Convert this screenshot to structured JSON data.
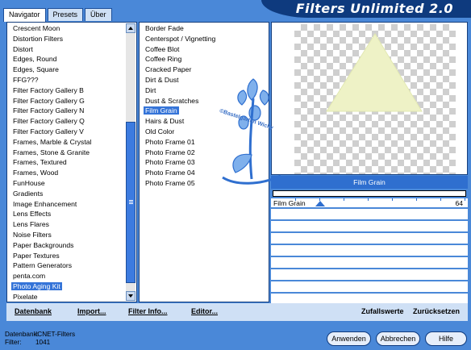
{
  "tabs": [
    {
      "label": "Navigator",
      "active": true
    },
    {
      "label": "Presets",
      "active": false
    },
    {
      "label": "Über",
      "active": false
    }
  ],
  "app_title": "Filters Unlimited 2.0",
  "categories": [
    "Crescent Moon",
    "Distortion Filters",
    "Distort",
    "Edges, Round",
    "Edges, Square",
    "FFG???",
    "Filter Factory Gallery B",
    "Filter Factory Gallery G",
    "Filter Factory Gallery N",
    "Filter Factory Gallery Q",
    "Filter Factory Gallery V",
    "Frames, Marble & Crystal",
    "Frames, Stone & Granite",
    "Frames, Textured",
    "Frames, Wood",
    "FunHouse",
    "Gradients",
    "Image Enhancement",
    "Lens Effects",
    "Lens Flares",
    "Noise Filters",
    "Paper Backgrounds",
    "Paper Textures",
    "Pattern Generators",
    "penta.com",
    "Photo Aging Kit",
    "Pixelate"
  ],
  "selected_category": "Photo Aging Kit",
  "filters": [
    "Border Fade",
    "Centerspot / Vignetting",
    "Coffee Blot",
    "Coffee Ring",
    "Cracked Paper",
    "Dirt & Dust",
    "Dirt",
    "Dust & Scratches",
    "Film Grain",
    "Hairs & Dust",
    "Old Color",
    "Photo Frame 01",
    "Photo Frame 02",
    "Photo Frame 03",
    "Photo Frame 04",
    "Photo Frame 05"
  ],
  "selected_filter": "Film Grain",
  "watermark_text": "©Bastelgarten Wicky",
  "filter_name_bar": "Film Grain",
  "sliders": [
    {
      "name": "Film Grain",
      "value": "64",
      "level": 0.251
    }
  ],
  "empty_slider_rows": 7,
  "bottom_links": {
    "database": "Datenbank",
    "import": "Import...",
    "filter_info": "Filter Info...",
    "editor": "Editor...",
    "random": "Zufallswerte",
    "reset": "Zurücksetzen"
  },
  "info": {
    "database_label": "Datenbank:",
    "database_value": "ICNET-Filters",
    "filter_label": "Filter:",
    "filter_value": "1041"
  },
  "buttons": {
    "apply": "Anwenden",
    "cancel": "Abbrechen",
    "help": "Hilfe"
  },
  "colors": {
    "accent": "#2f6fcf",
    "window": "#4a88d8",
    "preview_triangle": "#eef2c6"
  },
  "icons": [
    "scroll-up-icon",
    "scroll-down-icon",
    "flower-watermark-icon",
    "slider-thumb-icon"
  ]
}
